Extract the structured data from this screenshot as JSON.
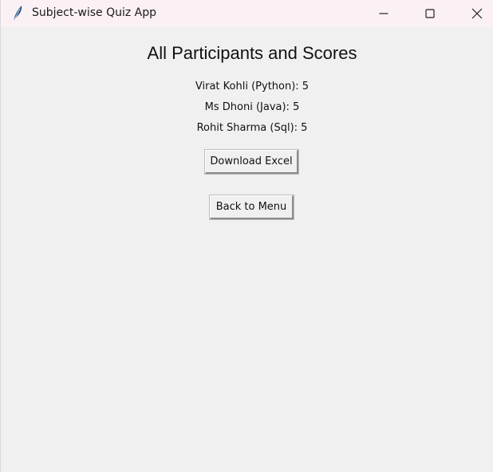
{
  "window": {
    "title": "Subject-wise Quiz App",
    "icon": "feather-icon"
  },
  "main": {
    "heading": "All Participants and Scores",
    "scores": [
      "Virat Kohli (Python): 5",
      "Ms Dhoni (Java): 5",
      "Rohit Sharma (Sql): 5"
    ],
    "download_label": "Download Excel",
    "back_label": "Back to Menu"
  },
  "colors": {
    "background": "#f0f0f0",
    "titlebar": "#fbf1f4"
  }
}
